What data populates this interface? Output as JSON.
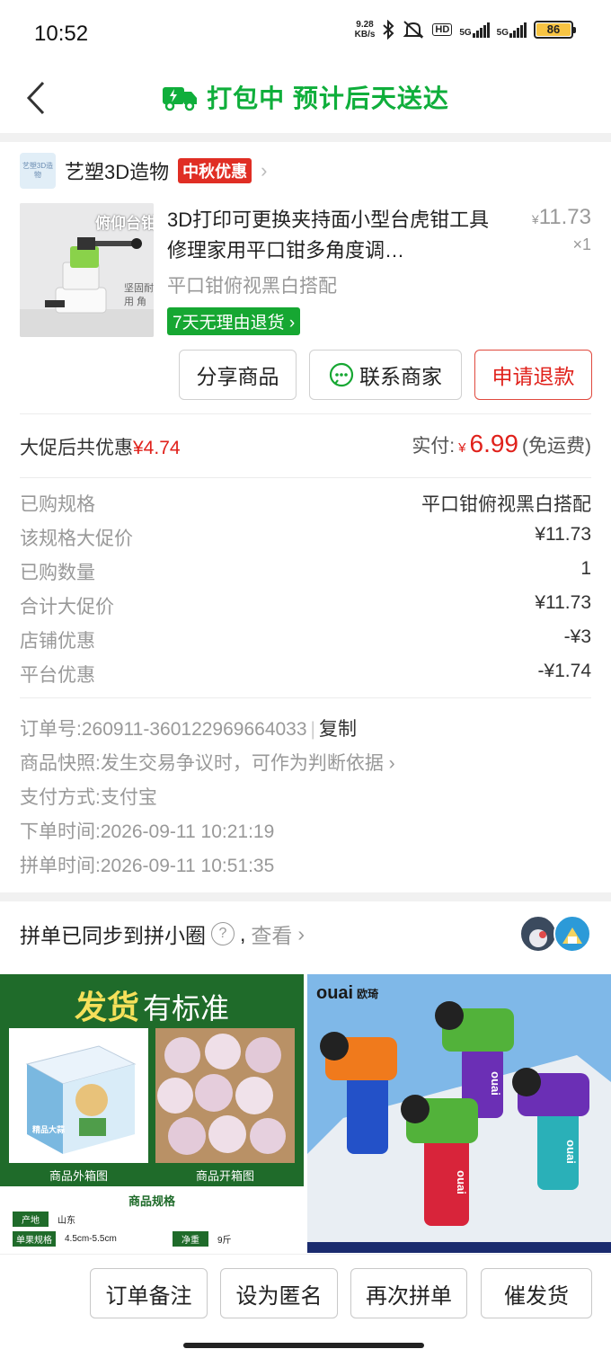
{
  "status_bar": {
    "time": "10:52",
    "net_speed_value": "9.28",
    "net_speed_unit": "KB/s",
    "hd_badge": "HD",
    "sim1": "5G",
    "sim2": "5G",
    "battery": "86"
  },
  "header": {
    "title": "打包中 预计后天送达",
    "accent": "#0fae3b"
  },
  "shop": {
    "logo_text": "艺塑3D造物",
    "name": "艺塑3D造物",
    "promo_badge": "中秋优惠"
  },
  "product": {
    "image_text_top": "俯仰台钳",
    "image_text_side": "坚固耐用 角度可调",
    "title": "3D打印可更换夹持面小型台虎钳工具修理家用平口钳多角度调…",
    "currency": "¥",
    "price": "11.73",
    "quantity": "×1",
    "spec": "平口钳俯视黑白搭配",
    "return_policy": "7天无理由退货"
  },
  "actions": {
    "share": "分享商品",
    "contact": "联系商家",
    "refund": "申请退款"
  },
  "summary": {
    "discount_label": "大促后共优惠",
    "discount_value": "¥4.74",
    "paid_label": "实付:",
    "paid_currency": "¥",
    "paid_value": "6.99",
    "shipping_note": "(免运费)"
  },
  "details": [
    {
      "label": "已购规格",
      "value": "平口钳俯视黑白搭配"
    },
    {
      "label": "该规格大促价",
      "value": "¥11.73"
    },
    {
      "label": "已购数量",
      "value": "1"
    },
    {
      "label": "合计大促价",
      "value": "¥11.73"
    },
    {
      "label": "店铺优惠",
      "value": "-¥3"
    },
    {
      "label": "平台优惠",
      "value": "-¥1.74"
    }
  ],
  "order_info": {
    "order_no_label": "订单号:",
    "order_no": "260911-360122969664033",
    "copy": "复制",
    "snapshot_label": "商品快照:",
    "snapshot_text": "发生交易争议时，可作为判断依据",
    "payment_label": "支付方式:",
    "payment": "支付宝",
    "order_time_label": "下单时间:",
    "order_time": "2026-09-11 10:21:19",
    "group_time_label": "拼单时间:",
    "group_time": "2026-09-11 10:51:35"
  },
  "sync": {
    "text": "拼单已同步到拼小圈",
    "help": "?",
    "comma": ",",
    "look": "查看"
  },
  "rec_left": {
    "headline_bold": "发货",
    "headline_rest": "有标准",
    "box_caption": "商品外箱图",
    "open_caption": "商品开箱图",
    "spec_title": "商品规格",
    "origin_label": "产地",
    "origin": "山东",
    "size_label": "单果规格",
    "size": "4.5cm-5.5cm",
    "weight_label": "净重",
    "weight": "9斤",
    "box_print": "精品大蒜"
  },
  "rec_right": {
    "brand": "ouai",
    "brand_cn": "欧琦",
    "product_print": "ouai"
  },
  "bottom_bar": {
    "note": "订单备注",
    "anonymous": "设为匿名",
    "regroup": "再次拼单",
    "urge": "催发货"
  }
}
